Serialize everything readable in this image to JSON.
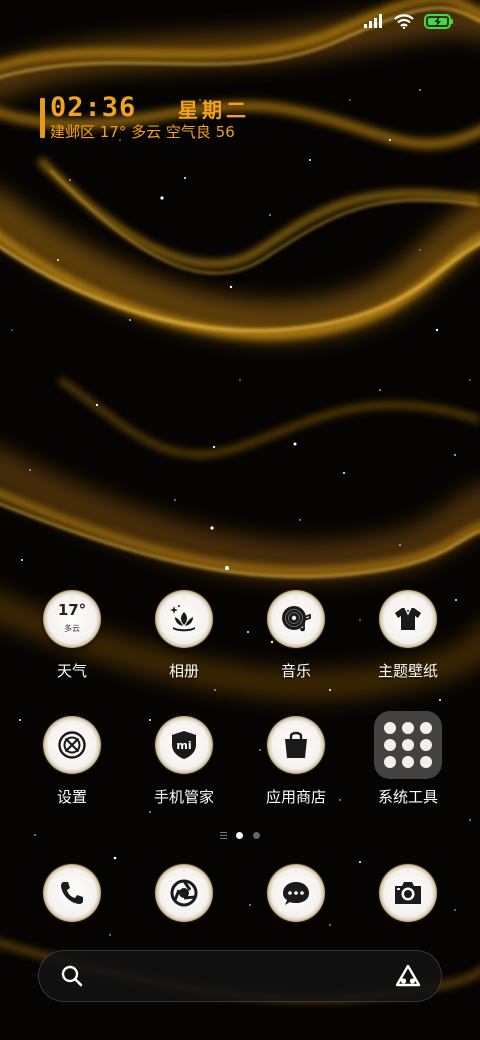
{
  "status_bar": {
    "icons": [
      "signal-icon",
      "wifi-icon",
      "battery-charging-icon"
    ],
    "battery_color": "#3ddc4a"
  },
  "clock_widget": {
    "time": "02:36",
    "weekday": "星期二",
    "weather_line": "建邺区 17° 多云 空气良 56",
    "accent_color": "#f0a21c"
  },
  "apps": [
    {
      "label": "天气",
      "icon": "weather-icon",
      "temp": "17°",
      "condition": "多云"
    },
    {
      "label": "相册",
      "icon": "gallery-icon"
    },
    {
      "label": "音乐",
      "icon": "music-icon"
    },
    {
      "label": "主题壁纸",
      "icon": "themes-icon"
    },
    {
      "label": "设置",
      "icon": "settings-icon"
    },
    {
      "label": "手机管家",
      "icon": "security-icon",
      "glyph_text": "mi"
    },
    {
      "label": "应用商店",
      "icon": "app-store-icon"
    },
    {
      "label": "系统工具",
      "icon": "folder-icon"
    }
  ],
  "page_indicator": {
    "pages": 2,
    "current": 1
  },
  "dock": [
    {
      "icon": "phone-icon"
    },
    {
      "icon": "browser-icon"
    },
    {
      "icon": "messages-icon"
    },
    {
      "icon": "camera-icon"
    }
  ],
  "search_bar": {
    "left_icon": "search-icon",
    "right_icon": "assistant-icon"
  }
}
